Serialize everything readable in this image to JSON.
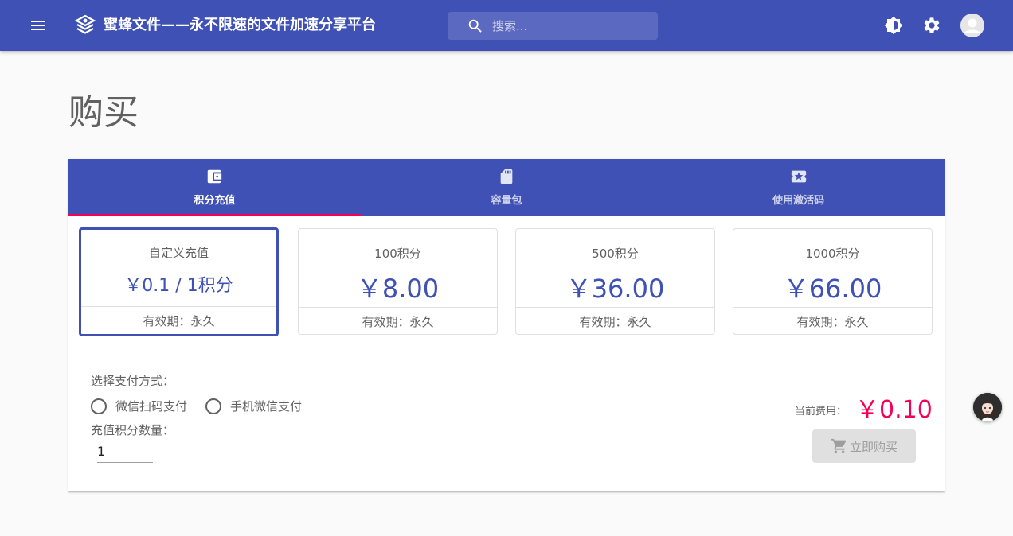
{
  "header": {
    "app_title": "蜜蜂文件——永不限速的文件加速分享平台",
    "search_placeholder": "搜索...",
    "icons": [
      "menu-icon",
      "logo-icon",
      "search-icon",
      "brightness-icon",
      "settings-icon",
      "avatar"
    ]
  },
  "page": {
    "title": "购买"
  },
  "tabs": [
    {
      "label": "积分充值",
      "icon": "wallet-icon",
      "active": true
    },
    {
      "label": "容量包",
      "icon": "sd-card-icon",
      "active": false
    },
    {
      "label": "使用激活码",
      "icon": "ticket-star-icon",
      "active": false
    }
  ],
  "packs": [
    {
      "name": "自定义充值",
      "price": "￥0.1 / 1积分",
      "validity": "有效期：永久",
      "selected": true
    },
    {
      "name": "100积分",
      "price": "￥8.00",
      "validity": "有效期：永久",
      "selected": false
    },
    {
      "name": "500积分",
      "price": "￥36.00",
      "validity": "有效期：永久",
      "selected": false
    },
    {
      "name": "1000积分",
      "price": "￥66.00",
      "validity": "有效期：永久",
      "selected": false
    }
  ],
  "payment": {
    "label": "选择支付方式：",
    "options": [
      "微信扫码支付",
      "手机微信支付"
    ],
    "quantity_label": "充值积分数量：",
    "quantity_value": "1"
  },
  "summary": {
    "cost_label": "当前费用：",
    "cost_value": "￥0.10",
    "buy_label": "立即购买",
    "buy_enabled": false
  },
  "colors": {
    "primary": "#3f51b5",
    "accent": "#f50057"
  }
}
